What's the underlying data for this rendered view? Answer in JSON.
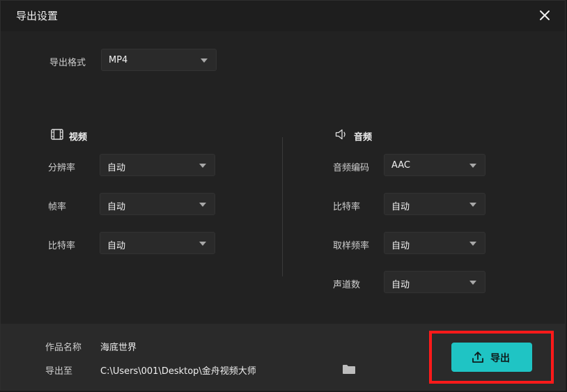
{
  "window": {
    "title": "导出设置"
  },
  "format": {
    "label": "导出格式",
    "value": "MP4"
  },
  "video": {
    "heading": "视频",
    "icon": "film-icon",
    "resolution": {
      "label": "分辨率",
      "value": "自动"
    },
    "framerate": {
      "label": "帧率",
      "value": "自动"
    },
    "bitrate": {
      "label": "比特率",
      "value": "自动"
    }
  },
  "audio": {
    "heading": "音频",
    "icon": "speaker-icon",
    "codec": {
      "label": "音频编码",
      "value": "AAC"
    },
    "bitrate": {
      "label": "比特率",
      "value": "自动"
    },
    "samplerate": {
      "label": "取样频率",
      "value": "自动"
    },
    "channels": {
      "label": "声道数",
      "value": "自动"
    }
  },
  "footer": {
    "name_label": "作品名称",
    "name_value": "海底世界",
    "path_label": "导出至",
    "path_value": "C:\\Users\\001\\Desktop\\金舟视频大师",
    "export_label": "导出"
  },
  "colors": {
    "accent": "#1fc4c4",
    "highlight": "#ff1a1a"
  }
}
